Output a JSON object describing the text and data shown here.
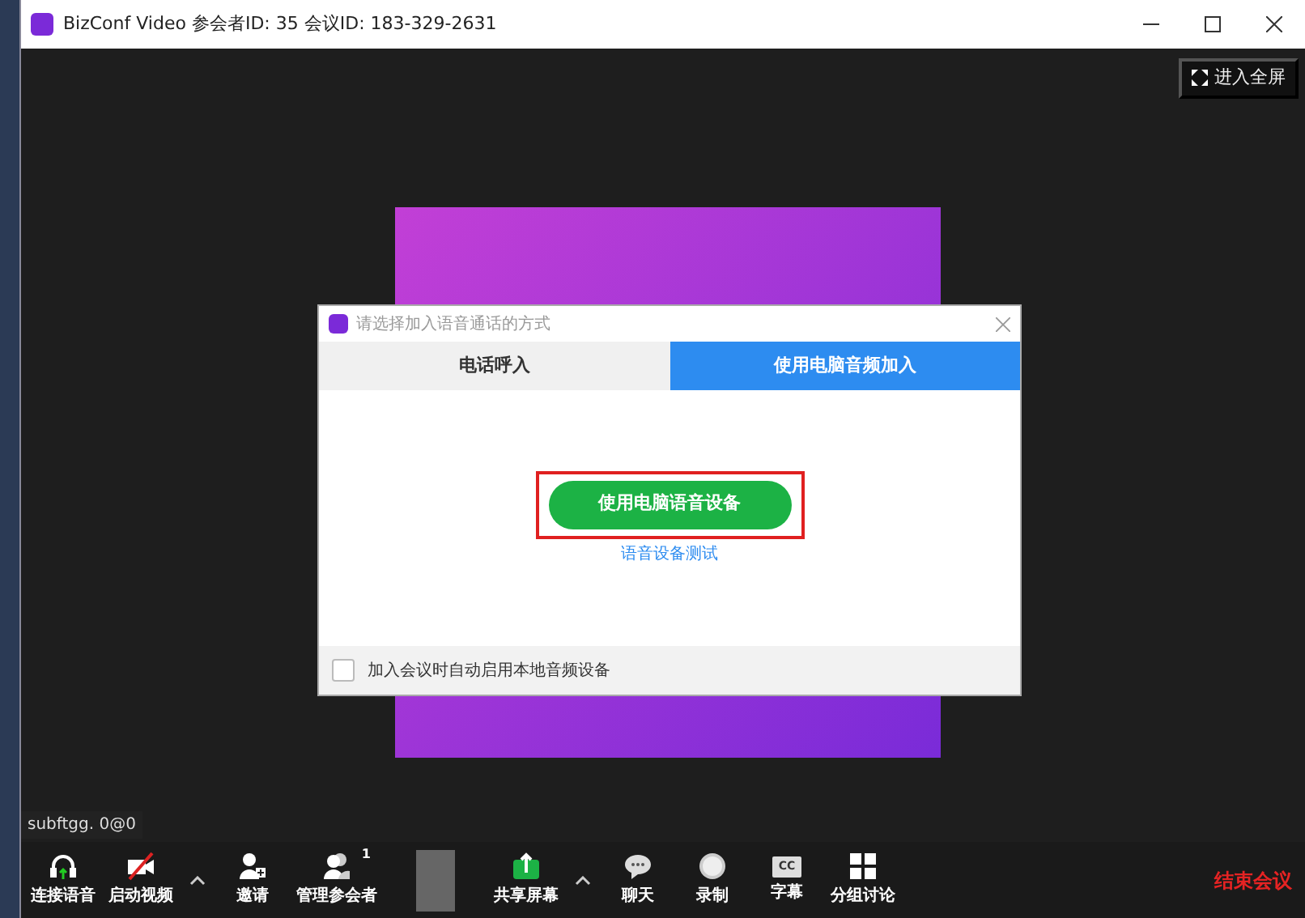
{
  "window": {
    "title": "BizConf Video 参会者ID: 35   会议ID: 183-329-2631"
  },
  "fullscreen_button": {
    "label": "进入全屏"
  },
  "dialog": {
    "title": "请选择加入语音通话的方式",
    "tabs": [
      {
        "label": "电话呼入",
        "selected": false
      },
      {
        "label": "使用电脑音频加入",
        "selected": true
      }
    ],
    "primary_button": {
      "label": "使用电脑语音设备",
      "highlighted": true
    },
    "test_link": {
      "label": "语音设备测试"
    },
    "auto_join": {
      "label": "加入会议时自动启用本地音频设备",
      "checked": false
    }
  },
  "participant_name": "subftgg. 0@0",
  "toolbar": [
    {
      "kind": "headset",
      "label": "连接语音"
    },
    {
      "kind": "video_off",
      "label": "启动视频"
    },
    {
      "kind": "caret"
    },
    {
      "kind": "invite",
      "label": "邀请"
    },
    {
      "kind": "participants",
      "label": "管理参会者",
      "badge": "1"
    },
    {
      "kind": "blurred"
    },
    {
      "kind": "share",
      "label": "共享屏幕"
    },
    {
      "kind": "caret"
    },
    {
      "kind": "chat",
      "label": "聊天"
    },
    {
      "kind": "record",
      "label": "录制"
    },
    {
      "kind": "cc",
      "label": "字幕",
      "icon_text": "CC"
    },
    {
      "kind": "breakout",
      "label": "分组讨论"
    },
    {
      "kind": "end",
      "label": "结束会议"
    }
  ]
}
